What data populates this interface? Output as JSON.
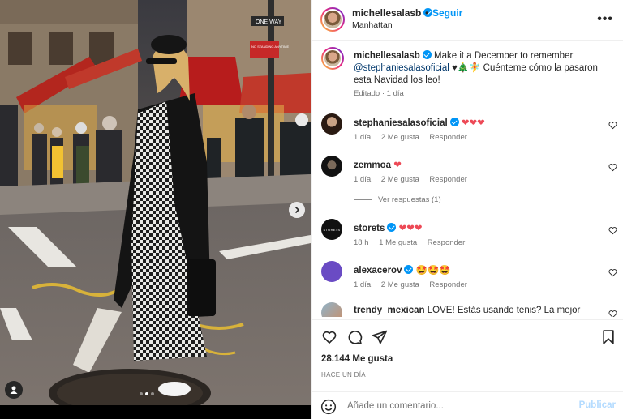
{
  "header": {
    "username": "michellesalasb",
    "separator": "•",
    "follow_label": "Seguir",
    "location": "Manhattan",
    "more_icon": "more-horizontal-icon",
    "more_label": "•••"
  },
  "caption": {
    "username": "michellesalasb",
    "text_before": " Make it a December to remember ",
    "mention": "@stephaniesalasoficial",
    "text_after": " ♥🎄🧚 Cuénteme cómo la pasaron esta Navidad los leo!",
    "meta": "Editado · 1 día"
  },
  "comments": [
    {
      "username": "stephaniesalasoficial",
      "verified": true,
      "text": "❤❤❤",
      "age": "1 día",
      "likes": "2 Me gusta",
      "reply": "Responder"
    },
    {
      "username": "zemmoa",
      "verified": false,
      "text": "❤",
      "age": "1 día",
      "likes": "2 Me gusta",
      "reply": "Responder"
    },
    {
      "username": "storets",
      "verified": true,
      "text": "❤❤❤",
      "age": "18 h",
      "likes": "1 Me gusta",
      "reply": "Responder"
    },
    {
      "username": "alexacerov",
      "verified": true,
      "text": "🤩🤩🤩",
      "age": "1 día",
      "likes": "2 Me gusta",
      "reply": "Responder"
    },
    {
      "username": "trendy_mexican",
      "verified": false,
      "text": "LOVE! Estás usando tenis? La mejor"
    }
  ],
  "view_replies": "Ver respuestas (1)",
  "actions": {
    "like_icon": "heart-icon",
    "comment_icon": "comment-icon",
    "share_icon": "share-icon",
    "save_icon": "bookmark-icon"
  },
  "likes_count": "28.144 Me gusta",
  "posted_time": "HACE UN DÍA",
  "add_comment": {
    "placeholder": "Añade un comentario...",
    "publish_label": "Publicar",
    "emoji_icon": "emoji-icon"
  },
  "media": {
    "carousel_count": 3,
    "carousel_active": 1,
    "next_icon": "chevron-right-icon",
    "user_tag_icon": "user-tag-icon",
    "storefront_sign": "NO STANDING ANYTIME",
    "street_sign": "ONE WAY",
    "storets_avatar_text": "STORETS"
  },
  "colors": {
    "accent": "#0095f6",
    "mention": "#00376b",
    "heart": "#ed4956",
    "muted": "#737373"
  }
}
